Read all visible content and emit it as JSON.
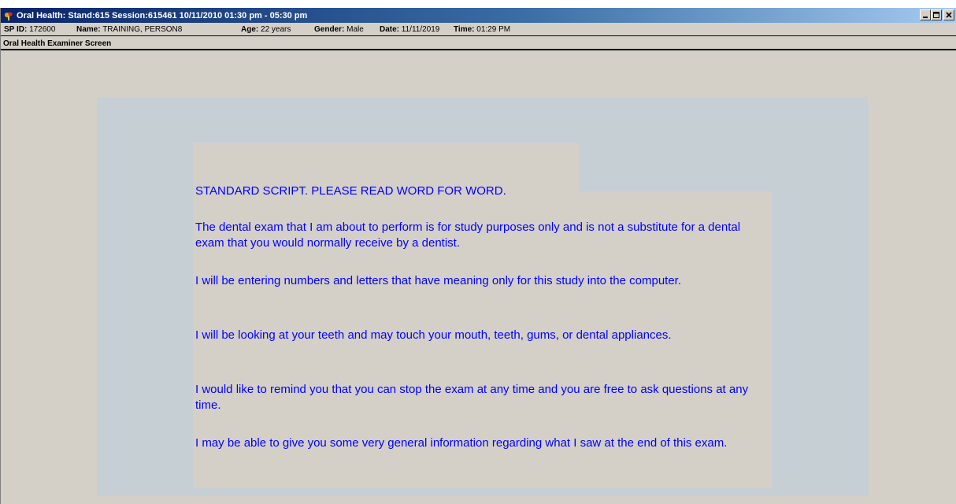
{
  "window": {
    "title": "Oral Health: Stand:615 Session:615461 10/11/2010 01:30 pm - 05:30 pm",
    "controls": [
      "minimize-icon",
      "maximize-icon",
      "close-icon"
    ]
  },
  "info": {
    "sp_id_label": "SP ID:",
    "sp_id_value": "172600",
    "name_label": "Name:",
    "name_value": "TRAINING, PERSON8",
    "age_label": "Age:",
    "age_value": "22 years",
    "gender_label": "Gender:",
    "gender_value": "Male",
    "date_label": "Date:",
    "date_value": "11/11/2019",
    "time_label": "Time:",
    "time_value": "01:29 PM"
  },
  "screen": {
    "title": "Oral Health Examiner Screen"
  },
  "script": {
    "heading": "STANDARD SCRIPT. PLEASE READ WORD FOR WORD.",
    "paragraphs": [
      "The dental exam that I am about to perform is for study purposes only and is not a substitute for a dental exam that you would normally receive by a dentist.",
      "I will be entering numbers and letters that have meaning only for this study into the computer.",
      "I will be looking at your teeth and may touch your mouth, teeth, gums, or dental appliances.",
      "I would like to remind you that you can stop the exam at any time and you are free to ask questions at any time.",
      "I may be able to give you some very general information regarding what I saw at the end of this exam."
    ]
  },
  "colors": {
    "script_text": "#0000ff",
    "window_bg": "#d4d0c8",
    "panel_bg": "#c6cfd4",
    "titlebar_start": "#0a246a",
    "titlebar_end": "#a6caf0"
  }
}
